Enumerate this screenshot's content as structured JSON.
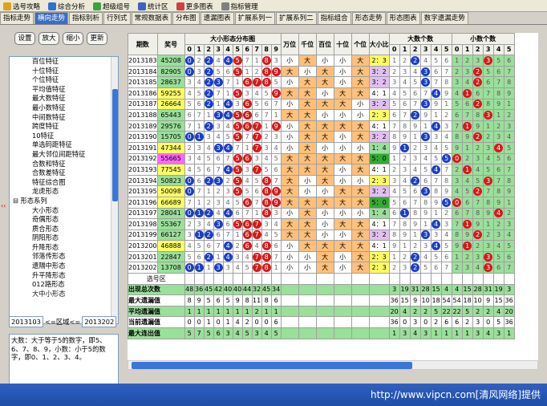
{
  "toolbar": {
    "items": [
      {
        "label": "选号攻略",
        "icon": "guide-icon"
      },
      {
        "label": "综合分析",
        "icon": "analysis-icon"
      },
      {
        "label": "超级组号",
        "icon": "combine-icon"
      },
      {
        "label": "统计区",
        "icon": "stats-icon"
      },
      {
        "label": "更多图表",
        "icon": "charts-icon"
      },
      {
        "label": "指标管理",
        "icon": "manage-icon"
      }
    ]
  },
  "tabs": [
    "指标走势",
    "横向走势",
    "指标别析",
    "行列式",
    "常规数据表",
    "分布图",
    "遗漏图表",
    "扩展系列一",
    "扩展系列二",
    "指标组合",
    "形态走势",
    "形态图表",
    "数字遗漏走势"
  ],
  "active_tab": 1,
  "left": {
    "buttons": [
      "设置",
      "放大",
      "缩小",
      "更新"
    ],
    "tree": [
      "百位特征",
      "十位特征",
      "个位特征",
      "平均值特征",
      "最大数特征",
      "最小数特征",
      "中间数特征",
      "跨度特征",
      "10特征",
      "单选码距特征",
      "最大邻位间距特征",
      "合数和特征",
      "合数差特征",
      "特征综合图",
      "龙虎形态",
      "⊟ 形态系列",
      "大小形态",
      "奇偶形态",
      "质合形态",
      "阴阳形态",
      "升降形态",
      "邻落传形态",
      "遗隔中形态",
      "升平降形态",
      "012路形态",
      "大中小形态"
    ],
    "range_from": "2013103",
    "range_label": "<=区域<=",
    "range_to": "2013202",
    "description": "大数：大于等于5的数字，即5、6、7、8、9，小数：小于5的数字，即0、1、2、3、4。"
  },
  "grid": {
    "header": {
      "period": "期数",
      "prize": "奖号",
      "dist": "大小形态分布图",
      "wan": "万位",
      "qian": "千位",
      "bai": "百位",
      "shi": "十位",
      "ge": "个位",
      "ratio": "大小比",
      "big": "大数个数",
      "small": "小数个数",
      "digits": [
        "0",
        "1",
        "2",
        "3",
        "4",
        "5",
        "6",
        "7",
        "8",
        "9"
      ],
      "counts": [
        "0",
        "1",
        "2",
        "3",
        "4",
        "5"
      ]
    },
    "rows": [
      {
        "period": "2013183",
        "prize": "45208",
        "cls": "g",
        "pos": [
          "小",
          "大",
          "小",
          "小",
          "大"
        ],
        "ratio": "2：3",
        "rc": "y"
      },
      {
        "period": "2013184",
        "prize": "82905",
        "cls": "g",
        "pos": [
          "大",
          "小",
          "大",
          "小",
          "大"
        ],
        "ratio": "3：2",
        "rc": "p"
      },
      {
        "period": "2013185",
        "prize": "28637",
        "cls": "g",
        "pos": [
          "小",
          "大",
          "大",
          "小",
          "大"
        ],
        "ratio": "3：2",
        "rc": "p"
      },
      {
        "period": "2013186",
        "prize": "59255",
        "cls": "y",
        "pos": [
          "大",
          "大",
          "小",
          "大",
          "大"
        ],
        "ratio": "4：1",
        "rc": "w"
      },
      {
        "period": "2013187",
        "prize": "26664",
        "cls": "y",
        "pos": [
          "小",
          "大",
          "大",
          "大",
          "小"
        ],
        "ratio": "3：2",
        "rc": "p"
      },
      {
        "period": "2013188",
        "prize": "65443",
        "cls": "g",
        "pos": [
          "大",
          "大",
          "小",
          "小",
          "小"
        ],
        "ratio": "2：3",
        "rc": "y"
      },
      {
        "period": "2013189",
        "prize": "29576",
        "cls": "g",
        "pos": [
          "小",
          "大",
          "大",
          "大",
          "大"
        ],
        "ratio": "4：1",
        "rc": "w"
      },
      {
        "period": "2013190",
        "prize": "15705",
        "cls": "g",
        "pos": [
          "小",
          "大",
          "大",
          "小",
          "大"
        ],
        "ratio": "3：2",
        "rc": "p"
      },
      {
        "period": "2013191",
        "prize": "47344",
        "cls": "y",
        "pos": [
          "小",
          "大",
          "小",
          "小",
          "小"
        ],
        "ratio": "1：4",
        "rc": "gr"
      },
      {
        "period": "2013192",
        "prize": "55665",
        "cls": "m",
        "pos": [
          "大",
          "大",
          "大",
          "大",
          "大"
        ],
        "ratio": "5：0",
        "rc": "dg"
      },
      {
        "period": "2013193",
        "prize": "77545",
        "cls": "y",
        "pos": [
          "大",
          "大",
          "大",
          "小",
          "大"
        ],
        "ratio": "4：1",
        "rc": "w"
      },
      {
        "period": "2013194",
        "prize": "50823",
        "cls": "g",
        "pos": [
          "大",
          "小",
          "大",
          "小",
          "小"
        ],
        "ratio": "2：3",
        "rc": "y"
      },
      {
        "period": "2013195",
        "prize": "50098",
        "cls": "y",
        "pos": [
          "大",
          "小",
          "小",
          "大",
          "大"
        ],
        "ratio": "3：2",
        "rc": "p"
      },
      {
        "period": "2013196",
        "prize": "66689",
        "cls": "y",
        "pos": [
          "大",
          "大",
          "大",
          "大",
          "大"
        ],
        "ratio": "5：0",
        "rc": "dg"
      },
      {
        "period": "2013197",
        "prize": "28041",
        "cls": "g",
        "pos": [
          "小",
          "大",
          "小",
          "小",
          "小"
        ],
        "ratio": "1：4",
        "rc": "gr"
      },
      {
        "period": "2013198",
        "prize": "55367",
        "cls": "g",
        "pos": [
          "大",
          "大",
          "小",
          "大",
          "大"
        ],
        "ratio": "4：1",
        "rc": "w"
      },
      {
        "period": "2013199",
        "prize": "66127",
        "cls": "g",
        "pos": [
          "大",
          "大",
          "小",
          "小",
          "大"
        ],
        "ratio": "3：2",
        "rc": "p"
      },
      {
        "period": "2013200",
        "prize": "46888",
        "cls": "y",
        "pos": [
          "小",
          "大",
          "大",
          "大",
          "大"
        ],
        "ratio": "4：1",
        "rc": "w"
      },
      {
        "period": "2013201",
        "prize": "22847",
        "cls": "g",
        "pos": [
          "小",
          "小",
          "大",
          "小",
          "大"
        ],
        "ratio": "2：3",
        "rc": "y"
      },
      {
        "period": "2013202",
        "prize": "13708",
        "cls": "g",
        "pos": [
          "小",
          "小",
          "大",
          "小",
          "大"
        ],
        "ratio": "2：3",
        "rc": "y"
      }
    ],
    "select_label": "选号区",
    "stats": [
      {
        "label": "出现总次数",
        "dist": [
          "48",
          "36",
          "45",
          "42",
          "40",
          "40",
          "44",
          "32",
          "45",
          "34"
        ],
        "big": [
          "",
          "3",
          "19",
          "31",
          "28",
          "15",
          "4"
        ],
        "small": [
          "4",
          "15",
          "28",
          "31",
          "19",
          "3"
        ]
      },
      {
        "label": "最大遗漏值",
        "dist": [
          "8",
          "9",
          "5",
          "6",
          "5",
          "9",
          "8",
          "11",
          "8",
          "6"
        ],
        "big": [
          "",
          "36",
          "15",
          "9",
          "10",
          "18",
          "54"
        ],
        "small": [
          "54",
          "18",
          "10",
          "9",
          "15",
          "36"
        ]
      },
      {
        "label": "平均遗漏值",
        "dist": [
          "1",
          "1",
          "1",
          "1",
          "1",
          "1",
          "1",
          "2",
          "1",
          "1"
        ],
        "big": [
          "",
          "20",
          "4",
          "2",
          "2",
          "5",
          "22"
        ],
        "small": [
          "22",
          "5",
          "2",
          "2",
          "4",
          "20"
        ]
      },
      {
        "label": "当前遗漏值",
        "dist": [
          "0",
          "0",
          "1",
          "0",
          "1",
          "4",
          "2",
          "0",
          "0",
          "6"
        ],
        "big": [
          "",
          "36",
          "0",
          "3",
          "0",
          "2",
          "6"
        ],
        "small": [
          "6",
          "2",
          "3",
          "0",
          "5",
          "36"
        ]
      },
      {
        "label": "最大连出值",
        "dist": [
          "5",
          "7",
          "5",
          "6",
          "3",
          "4",
          "5",
          "3",
          "4",
          "5"
        ],
        "big": [
          "",
          "1",
          "3",
          "4",
          "3",
          "1",
          "1"
        ],
        "small": [
          "1",
          "1",
          "3",
          "4",
          "3",
          "1"
        ]
      }
    ]
  },
  "watermark": "http://www.vipcn.com[清风网络]提供",
  "colors": {
    "accent": "#3a6ec5",
    "green": "#7ed07e",
    "yellow": "#ffff66",
    "magenta": "#ff66ff",
    "blue_ball": "#1a3ec8",
    "red_ball": "#d81818"
  }
}
